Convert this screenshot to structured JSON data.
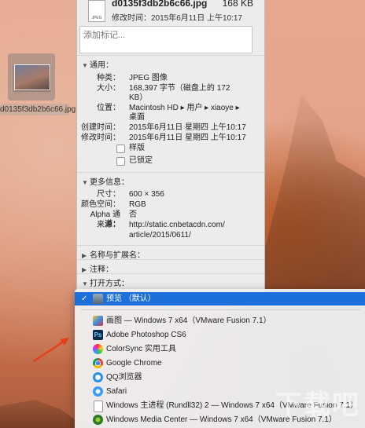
{
  "desktop": {
    "file_name": "d0135f3db2b6c66.jpg"
  },
  "info": {
    "header": {
      "name": "d0135f3db2b6c66.jpg",
      "size": "168 KB",
      "modified": "修改时间：2015年6月11日 上午10:17",
      "icon_text": "JPEG"
    },
    "tags_placeholder": "添加标记...",
    "general": {
      "title": "通用：",
      "kind_label": "种类：",
      "kind": "JPEG 图像",
      "size_label": "大小：",
      "size": "168,397 字节（磁盘上的 172",
      "size2": "KB）",
      "where_label": "位置：",
      "where": "Macintosh HD ▸ 用户 ▸ xiaoye ▸",
      "where2": "桌面",
      "created_label": "创建时间：",
      "created": "2015年6月11日 星期四 上午10:17",
      "modified_label": "修改时间：",
      "modified": "2015年6月11日 星期四 上午10:17",
      "stationery": "样版",
      "locked": "已锁定"
    },
    "more": {
      "title": "更多信息：",
      "dim_label": "尺寸：",
      "dim": "600 × 356",
      "color_label": "颜色空间：",
      "color": "RGB",
      "alpha_label": "Alpha 通道：",
      "alpha": "否",
      "source_label": "来源：",
      "source": "http://static.cnbetacdn.com/",
      "source2": "article/2015/0611/"
    },
    "name_ext": "名称与扩展名：",
    "comments": "注释：",
    "open_with": "打开方式："
  },
  "menu": {
    "selected": {
      "check": "✓",
      "label": "预览 （默认）"
    },
    "items": [
      {
        "label": "画图 — Windows 7 x64（VMware Fusion 7.1）",
        "icon": "paint-icon"
      },
      {
        "label": "Adobe Photoshop CS6",
        "icon": "photoshop-icon"
      },
      {
        "label": "ColorSync 实用工具",
        "icon": "colorsync-icon"
      },
      {
        "label": "Google Chrome",
        "icon": "chrome-icon"
      },
      {
        "label": "QQ浏览器",
        "icon": "qq-browser-icon"
      },
      {
        "label": "Safari",
        "icon": "safari-icon"
      },
      {
        "label": "Windows 主进程 (Rundll32) 2 — Windows 7 x64（VMware Fusion 7.1）",
        "icon": "windows-file-icon"
      },
      {
        "label": "Windows Media Center — Windows 7 x64（VMware Fusion 7.1）",
        "icon": "media-center-icon"
      }
    ]
  },
  "watermark": "下载吧"
}
